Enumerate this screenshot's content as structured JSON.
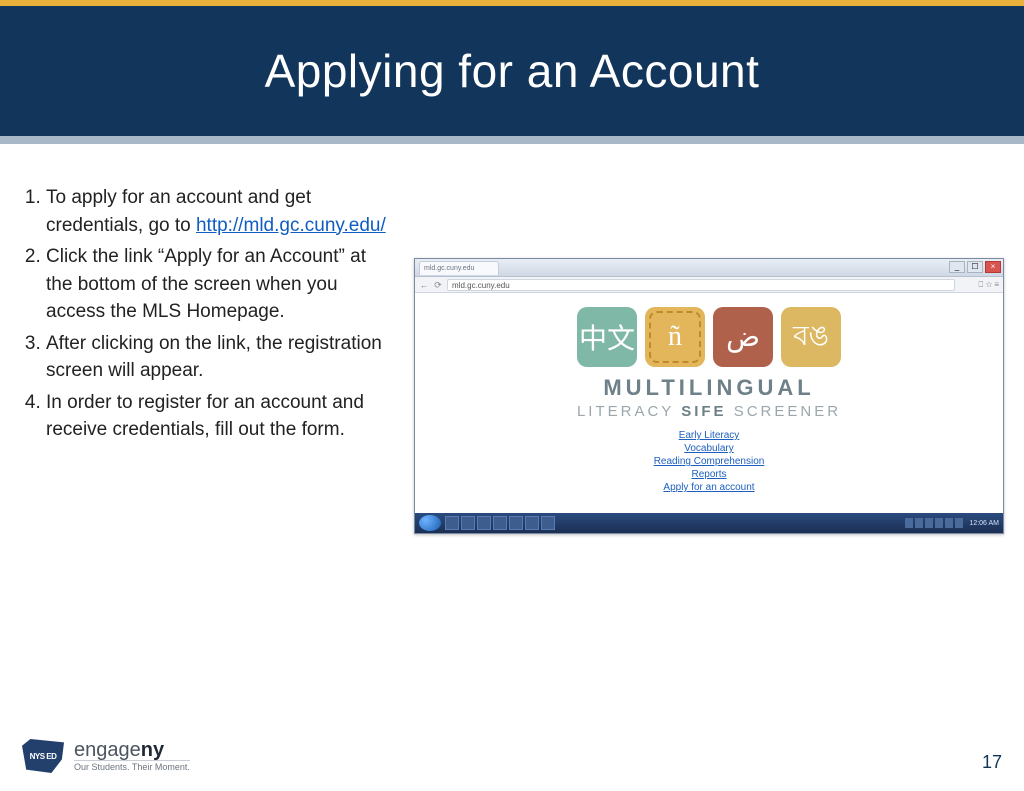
{
  "header": {
    "title": "Applying for an Account"
  },
  "steps": {
    "item1_pre": "To apply for an account and get credentials, go to ",
    "item1_link": "http://mld.gc.cuny.edu/",
    "item2": "Click the link “Apply for an Account” at the bottom of the screen when you access the MLS Homepage.",
    "item3": "After clicking on the link, the registration screen will appear.",
    "item4": "In order to register for an account and receive credentials, fill out the form."
  },
  "screenshot": {
    "tab_label": "mld.gc.cuny.edu",
    "url": "mld.gc.cuny.edu",
    "tiles": {
      "t1": "中文",
      "t2": "ñ",
      "t3": "ض",
      "t4": "বঙ"
    },
    "brand_line1": "MULTILINGUAL",
    "brand_line2_a": "LITERACY ",
    "brand_line2_b": "SIFE",
    "brand_line2_c": " SCREENER",
    "links": {
      "l1": "Early Literacy",
      "l2": "Vocabulary",
      "l3": "Reading Comprehension",
      "l4": "Reports",
      "l5": "Apply for an account"
    },
    "clock": "12:06 AM"
  },
  "footer": {
    "engage_line1_a": "engage",
    "engage_line1_b": "ny",
    "engage_line2": "Our Students. Their Moment.",
    "page_number": "17"
  }
}
